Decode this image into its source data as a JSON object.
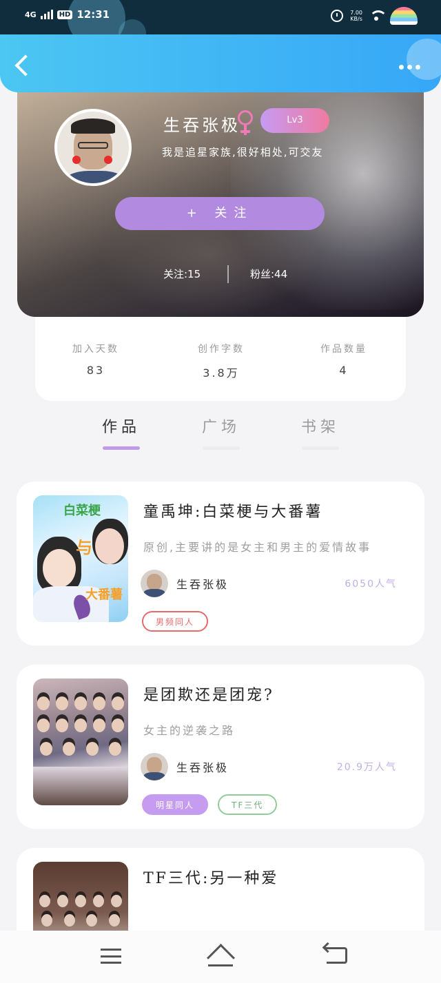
{
  "status_bar": {
    "network": "4G",
    "hd": "HD",
    "time": "12:31",
    "speed_value": "7.00",
    "speed_unit": "KB/s"
  },
  "profile": {
    "username": "生吞张极",
    "level": "Lv3",
    "bio": "我是追星家族,很好相处,可交友",
    "follow_button": "+ 关注",
    "following": "关注:15",
    "fans": "粉丝:44"
  },
  "stats": [
    {
      "label": "加入天数",
      "value": "83"
    },
    {
      "label": "创作字数",
      "value": "3.8万"
    },
    {
      "label": "作品数量",
      "value": "4"
    }
  ],
  "tabs": [
    {
      "label": "作品",
      "active": true
    },
    {
      "label": "广场",
      "active": false
    },
    {
      "label": "书架",
      "active": false
    }
  ],
  "works": [
    {
      "title": "童禹坤:白菜梗与大番薯",
      "description": "原创,主要讲的是女主和男主的爱情故事",
      "author": "生吞张极",
      "popularity": "6050人气",
      "cover_texts": [
        "白菜梗",
        "与",
        "大番薯"
      ],
      "tags": [
        {
          "label": "男频同人",
          "style": "red"
        }
      ]
    },
    {
      "title": "是团欺还是团宠?",
      "description": "女主的逆袭之路",
      "author": "生吞张极",
      "popularity": "20.9万人气",
      "tags": [
        {
          "label": "明星同人",
          "style": "purple"
        },
        {
          "label": "TF三代",
          "style": "green"
        }
      ]
    },
    {
      "title": "TF三代:另一种爱",
      "description": ""
    }
  ],
  "colors": {
    "accent_purple": "#b28be0",
    "nav_blue": "#36a7f7",
    "level_gradient_start": "#c59bf3",
    "level_gradient_end": "#f07aa0"
  }
}
